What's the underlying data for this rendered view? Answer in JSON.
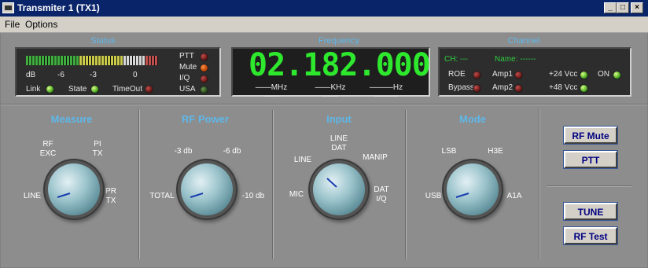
{
  "window": {
    "title": "Transmiter 1  (TX1)",
    "min_glyph": "_",
    "max_glyph": "□",
    "close_glyph": "×"
  },
  "menu": {
    "items": [
      {
        "label": "File",
        "underline": "F"
      },
      {
        "label": "Options",
        "underline": "O"
      }
    ]
  },
  "status": {
    "title": "Status",
    "meter_labels": [
      "dB",
      "-6",
      "-3",
      "0"
    ],
    "indicators": [
      "PTT",
      "Mute",
      "I/Q",
      "USA"
    ],
    "bottom": [
      "Link",
      "State",
      "TimeOut"
    ]
  },
  "frequency": {
    "title": "Frequency",
    "display": "02.182.000",
    "units": [
      "MHz",
      "KHz",
      "Hz"
    ]
  },
  "channel": {
    "title": "Channel",
    "ch_label": "CH: ---",
    "name_label": "Name: ------",
    "indicators": [
      "ROE",
      "Bypass",
      "Amp1",
      "Amp2",
      "+24 Vcc",
      "+48 Vcc",
      "ON"
    ]
  },
  "measure": {
    "title": "Measure",
    "labels": [
      "RF",
      "EXC",
      "PI",
      "TX",
      "LINE",
      "PR",
      "TX"
    ]
  },
  "rf_power": {
    "title": "RF Power",
    "labels": [
      "-3 db",
      "-6 db",
      "TOTAL",
      "-10 db"
    ]
  },
  "input": {
    "title": "Input",
    "labels": [
      "LINE",
      "DAT",
      "LINE",
      "MANIP",
      "MIC",
      "DAT",
      "I/Q"
    ]
  },
  "mode": {
    "title": "Mode",
    "labels": [
      "LSB",
      "H3E",
      "USB",
      "A1A"
    ]
  },
  "buttons": {
    "rf_mute": "RF Mute",
    "ptt": "PTT",
    "tune": "TUNE",
    "rf_test": "RF Test"
  },
  "colors": {
    "accent_label": "#5fb7e8",
    "lcd_green": "#2ee82e",
    "led_red": "#c0504d",
    "led_green": "#7fe22a"
  }
}
